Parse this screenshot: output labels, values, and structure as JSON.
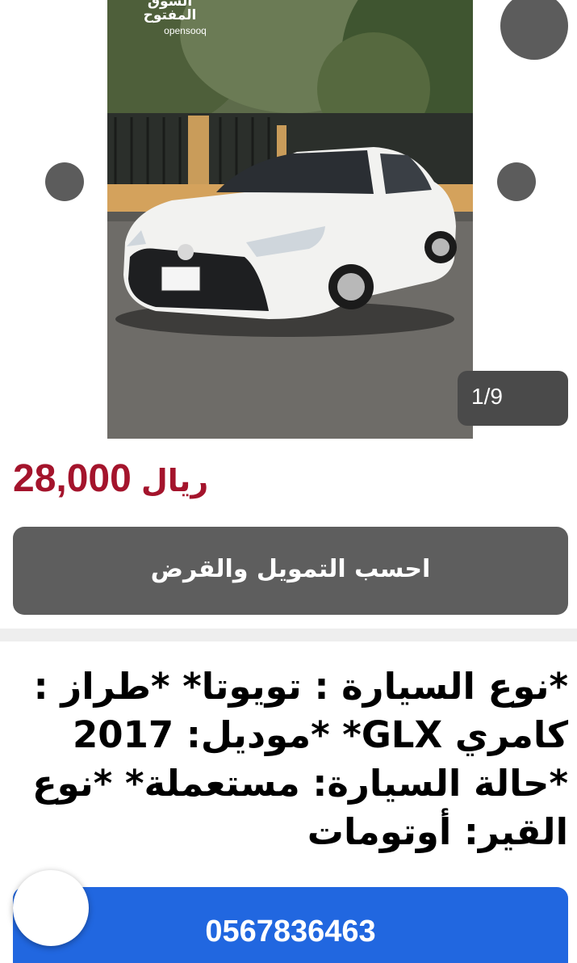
{
  "gallery": {
    "watermark_ar": "السوق المفتوح",
    "watermark_en": "opensooq",
    "counter": "1/9",
    "prev_icon": "circle-prev-icon",
    "next_icon": "circle-next-icon",
    "fav_icon": "circle-favorite-icon"
  },
  "listing": {
    "price_amount": "28,000",
    "price_currency": "ريال",
    "price_color": "#a4142c",
    "finance_button_label": "احسب التمويل والقرض",
    "description": "*نوع السيارة : تويوتا* *طراز : كامري GLX* *موديل: 2017 *حالة السيارة: مستعملة* *نوع القير: أوتومات"
  },
  "contact": {
    "phone": "0567836463",
    "phone_button_color": "#2167e0",
    "chat_icon": "chat-bubble-icon"
  }
}
